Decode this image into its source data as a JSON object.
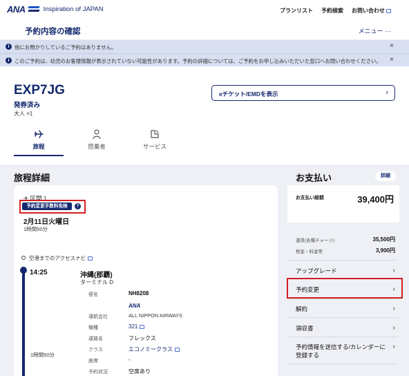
{
  "header": {
    "logo_text": "ANA",
    "tagline": "Inspiration of JAPAN",
    "nav": [
      "プランリスト",
      "予約検索",
      "お問い合わせ"
    ]
  },
  "page": {
    "title": "予約内容の確認",
    "menu_label": "メニュー ···"
  },
  "notices": [
    {
      "text": "他にお預かりしているご予約はありません。",
      "close": "×"
    },
    {
      "text": "このご予約は、幼児のお客様情報が表示されていない可能性があります。予約の詳細については、ご予約をお申し込みいただいた窓口へお問い合わせください。",
      "close": "×"
    }
  ],
  "booking": {
    "code": "EXP7JG",
    "status": "発券済み",
    "passengers": "大人 ×1",
    "eticket_label": "eチケット/EMDを表示",
    "eticket_chevron": "›"
  },
  "tabs": [
    {
      "label": "旅程",
      "icon": "plane-icon",
      "active": true
    },
    {
      "label": "搭乗者",
      "icon": "person-icon",
      "active": false
    },
    {
      "label": "サービス",
      "icon": "service-icon",
      "active": false
    }
  ],
  "itinerary": {
    "section_title": "旅程詳細",
    "segment_label": "✈ 区間 1",
    "change_fee_chip": "予約変更手数料免除",
    "help_icon": "?",
    "date": "2月11日火曜日",
    "duration": "1時間50分",
    "access_navi": "空港までのアクセスナビ",
    "departure_time": "14:25",
    "departure_city": "沖縄(那覇)",
    "terminal": "ターミナル D",
    "leg_duration": "1時間50分",
    "details": [
      {
        "label": "便名",
        "value": "NH8208",
        "link": false
      },
      {
        "label": "",
        "value": "ANA",
        "link": false
      },
      {
        "label": "運航会社",
        "value": "ALL NIPPON AIRWAYS",
        "link": false
      },
      {
        "label": "機種",
        "value": "321",
        "link": true
      },
      {
        "label": "運賃名",
        "value": "フレックス",
        "link": false
      },
      {
        "label": "クラス",
        "value": "エコノミークラス",
        "link": true
      },
      {
        "label": "座席",
        "value": "-",
        "link": false
      },
      {
        "label": "予約状況",
        "value": "空席あり",
        "link": false
      }
    ]
  },
  "payment": {
    "title": "お支払い",
    "detail_label": "詳細",
    "total_label": "お支払い総額",
    "total_amount": "39,400円",
    "breakdown": [
      {
        "label": "運賃(各種チャージ)",
        "value": "35,500円"
      },
      {
        "label": "税金・料金等",
        "value": "3,900円"
      }
    ],
    "actions": [
      {
        "label": "アップグレード",
        "chevron": "›"
      },
      {
        "label": "予約変更",
        "chevron": "›"
      },
      {
        "label": "解約",
        "chevron": "›"
      },
      {
        "label": "領収書",
        "chevron": "›"
      },
      {
        "label": "予約情報を送信する/カレンダーに登録する",
        "chevron": "›"
      }
    ]
  },
  "colors": {
    "brand": "#14286e",
    "notice_bg": "#d8dff0",
    "highlight": "#d21f1f",
    "page_bg": "#eef0f6"
  }
}
